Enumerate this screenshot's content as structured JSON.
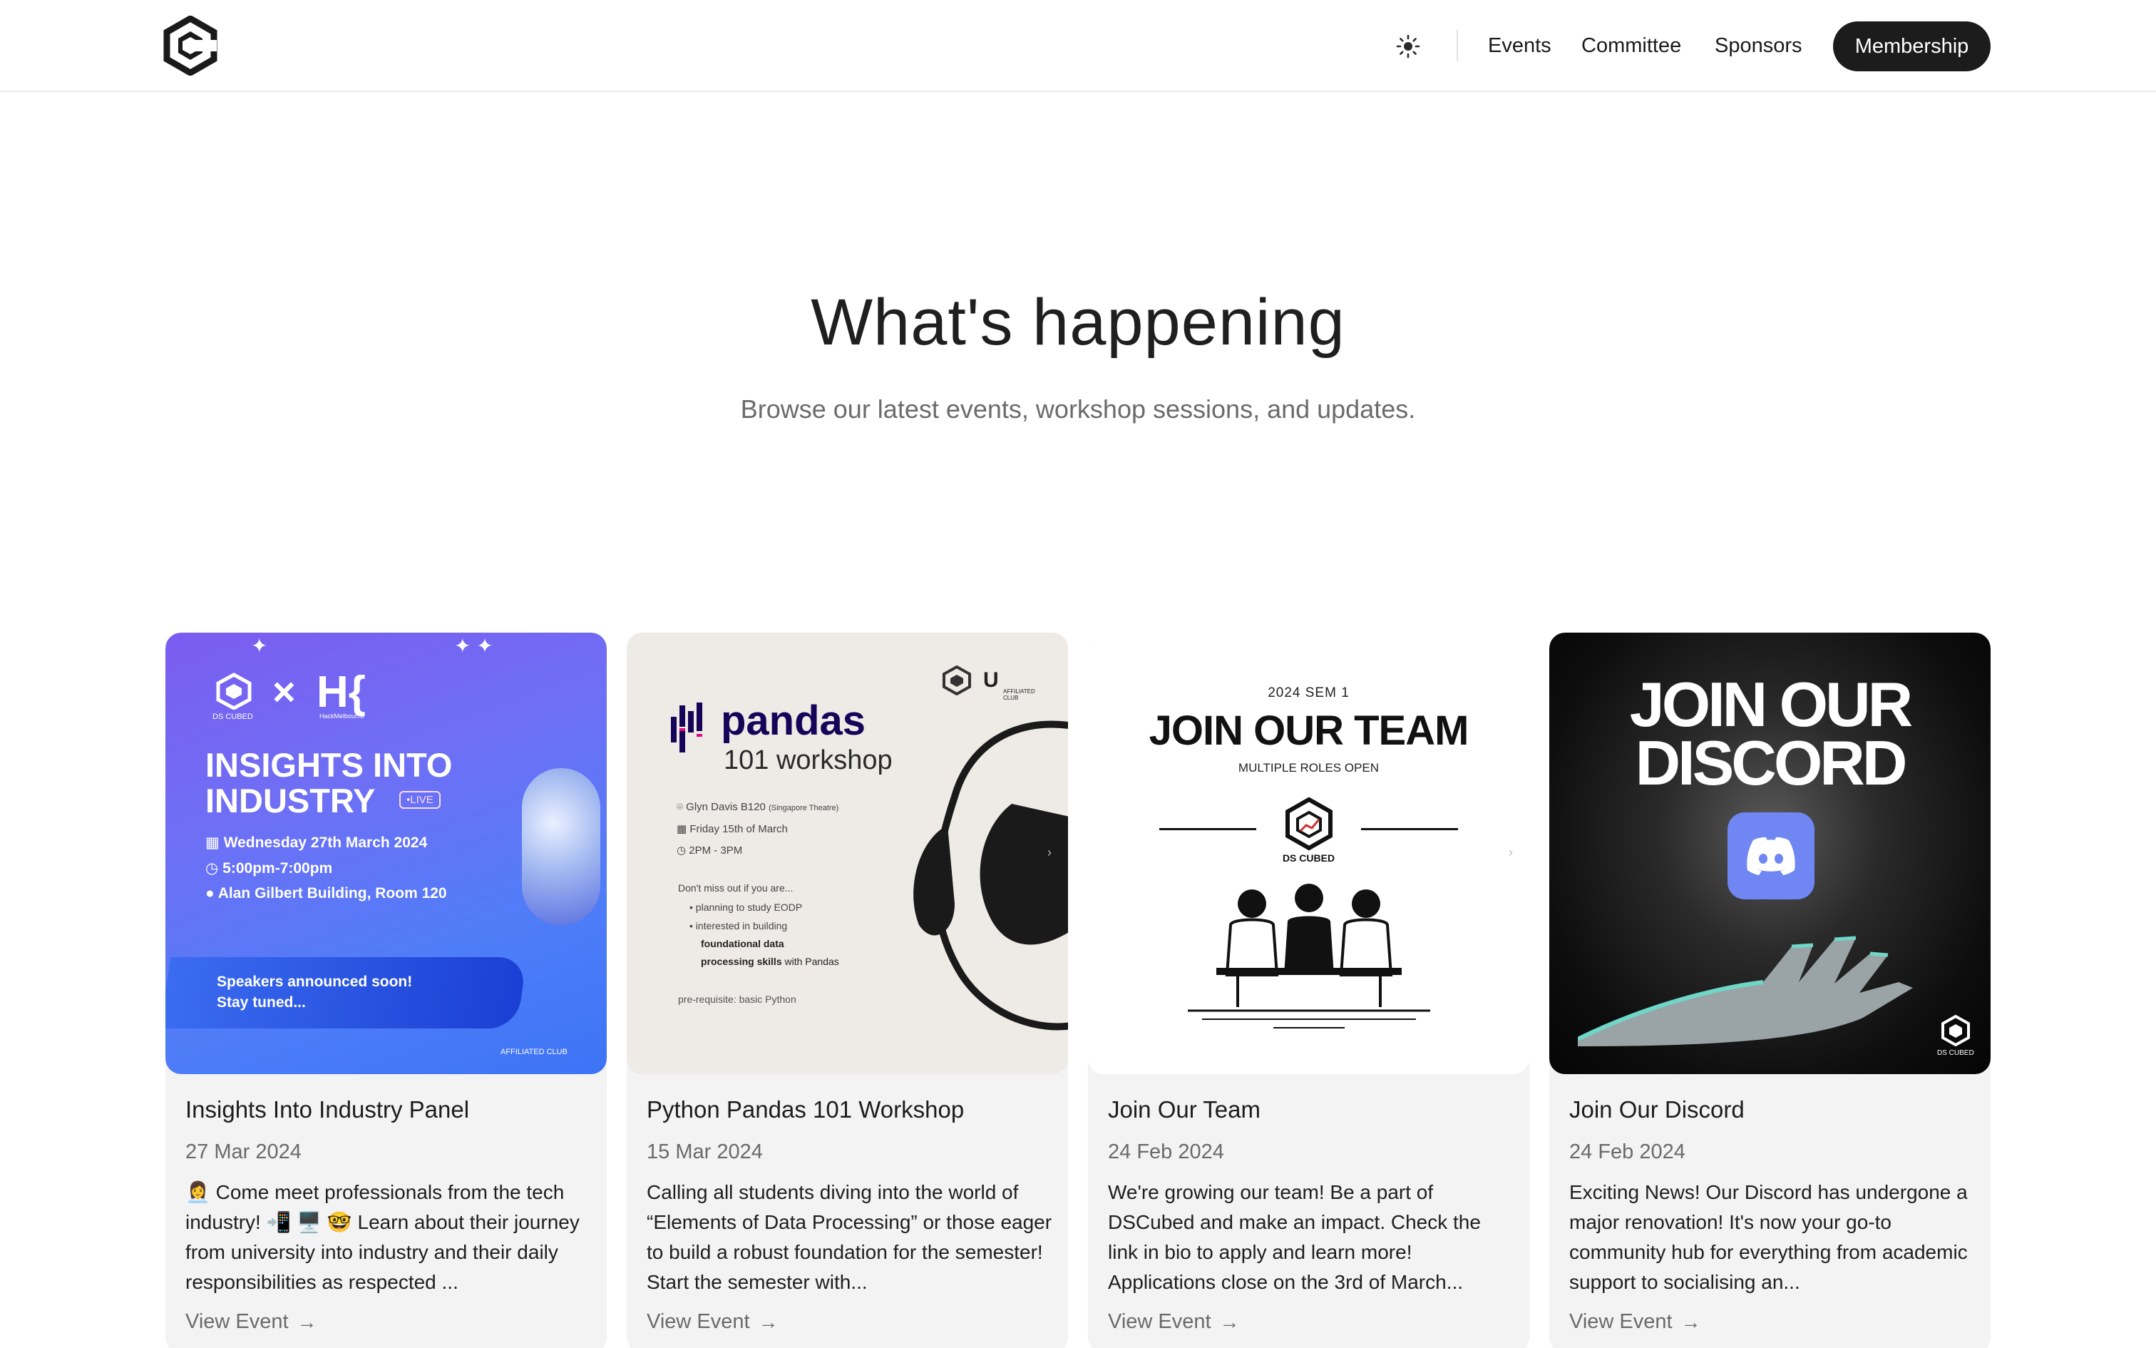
{
  "nav": {
    "logo_icon": "ds-cubed-logo",
    "theme_icon": "sun-icon",
    "events": "Events",
    "committee": "Committee",
    "sponsors": "Sponsors",
    "membership": "Membership"
  },
  "hero": {
    "title": "What's happening",
    "subtitle": "Browse our latest events, workshop sessions, and updates."
  },
  "cards": [
    {
      "title": "Insights Into Industry Panel",
      "date": "27 Mar 2024",
      "description": "👩‍💼 Come meet professionals from the tech industry! 📲 🖥️ 🤓 Learn about their journey from university into industry and their daily responsibilities as respected ...",
      "link": "View Event",
      "poster": {
        "brand_left": "DS CUBED",
        "brand_x": "×",
        "brand_right": "H{",
        "brand_right_sub": "HackMelbourne",
        "headline_1": "INSIGHTS INTO",
        "headline_2": "INDUSTRY",
        "live_badge": "•LIVE",
        "date_line": "Wednesday 27th March 2024",
        "time_line": "5:00pm-7:00pm",
        "place_line": "Alan Gilbert Building, Room 120",
        "banner_1": "Speakers announced soon!",
        "banner_2": "Stay tuned...",
        "footer": "AFFILIATED CLUB"
      }
    },
    {
      "title": "Python Pandas 101 Workshop",
      "date": "15 Mar 2024",
      "description": "Calling all students diving into the world of “Elements of Data Processing” or those eager to build a robust foundation for the semester! Start the semester with...",
      "link": "View Event",
      "poster": {
        "logo_word": "pandas",
        "subtitle": "101 workshop",
        "location": "Glyn Davis B120",
        "location_note": "(Singapore Theatre)",
        "date": "Friday 15th of March",
        "time": "2PM - 3PM",
        "intro": "Don't miss out if you are...",
        "bullet_1": "planning to study EODP",
        "bullet_2": "interested in building",
        "bullet_3": "foundational data",
        "bullet_4": "processing skills",
        "bullet_4_tail": "with Pandas",
        "prereq": "pre-requisite: basic Python",
        "club": "AFFILIATED CLUB"
      }
    },
    {
      "title": "Join Our Team",
      "date": "24 Feb 2024",
      "description": "We're growing our team! Be a part of DSCubed and make an impact. Check the link in bio to apply and learn more! Applications close on the 3rd of March...",
      "link": "View Event",
      "poster": {
        "kicker": "2024 SEM 1",
        "headline": "JOIN OUR TEAM",
        "roles": "MULTIPLE ROLES OPEN",
        "brand": "DS CUBED"
      }
    },
    {
      "title": "Join Our Discord",
      "date": "24 Feb 2024",
      "description": "Exciting News! Our Discord has undergone a major renovation! It's now your go-to community hub for everything from academic support to socialising an...",
      "link": "View Event",
      "poster": {
        "headline_1": "JOIN OUR",
        "headline_2": "DISCORD",
        "brand": "DS CUBED"
      }
    }
  ],
  "colors": {
    "accent_dark": "#1c1c1c",
    "card_bg": "#f3f3f3",
    "muted_text": "#6a6a6a"
  }
}
